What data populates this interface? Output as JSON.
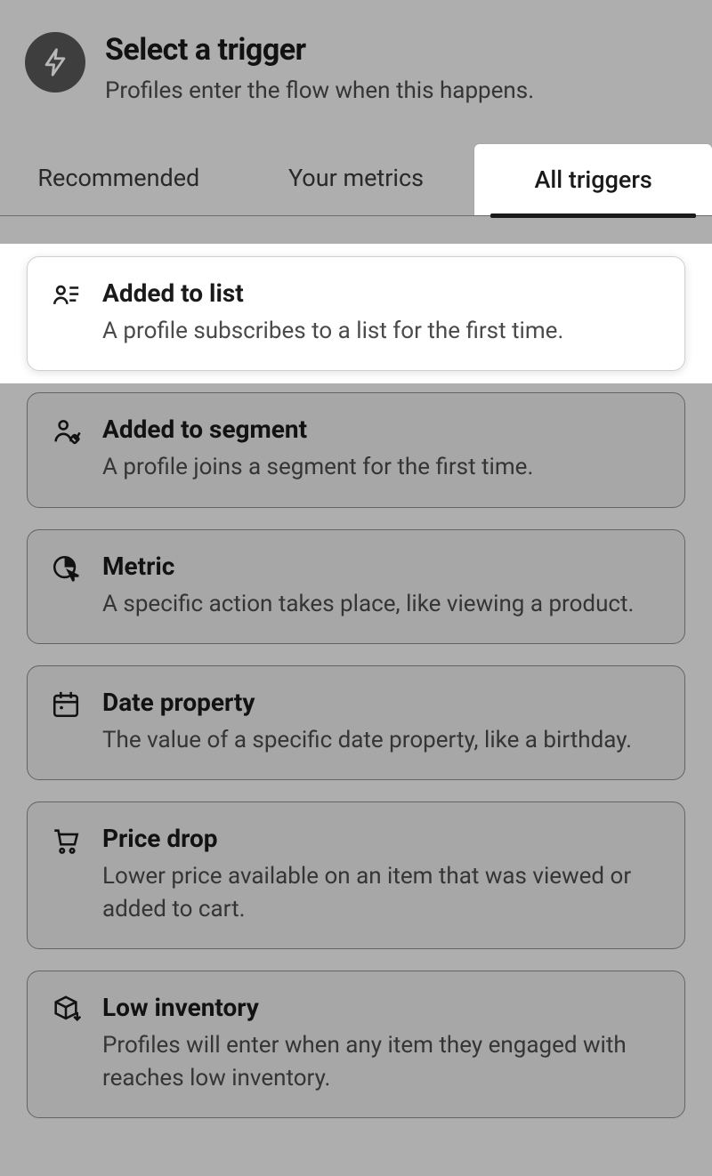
{
  "header": {
    "title": "Select a trigger",
    "subtitle": "Profiles enter the flow when this happens."
  },
  "tabs": [
    {
      "label": "Recommended",
      "active": false
    },
    {
      "label": "Your metrics",
      "active": false
    },
    {
      "label": "All triggers",
      "active": true
    }
  ],
  "triggers": [
    {
      "icon": "user-list-icon",
      "title": "Added to list",
      "desc": "A profile subscribes to a list for the first time.",
      "highlighted": true
    },
    {
      "icon": "user-segment-icon",
      "title": "Added to segment",
      "desc": "A profile joins a segment for the first time.",
      "highlighted": false
    },
    {
      "icon": "chart-click-icon",
      "title": "Metric",
      "desc": "A specific action takes place, like viewing a product.",
      "highlighted": false
    },
    {
      "icon": "calendar-icon",
      "title": "Date property",
      "desc": "The value of a specific date property, like a birthday.",
      "highlighted": false
    },
    {
      "icon": "cart-icon",
      "title": "Price drop",
      "desc": "Lower price available on an item that was viewed or added to cart.",
      "highlighted": false
    },
    {
      "icon": "box-down-icon",
      "title": "Low inventory",
      "desc": "Profiles will enter when any item they engaged with reaches low inventory.",
      "highlighted": false
    }
  ]
}
